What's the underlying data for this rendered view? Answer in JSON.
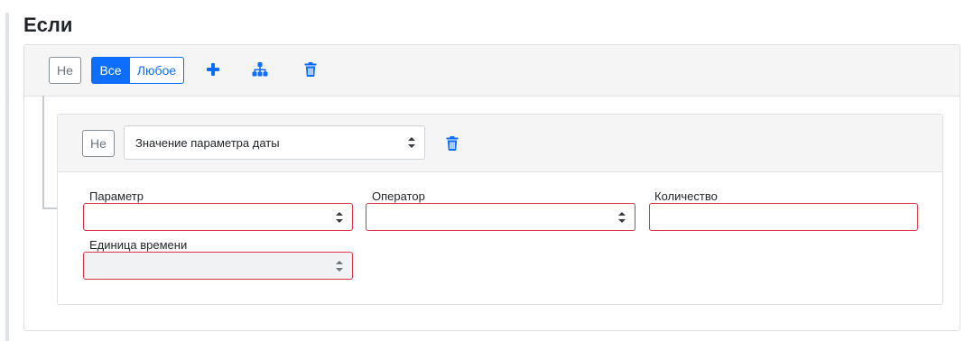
{
  "section": {
    "title": "Если"
  },
  "group": {
    "not_label": "Не",
    "all_label": "Все",
    "any_label": "Любое",
    "icons": [
      "plus-icon",
      "sitemap-icon",
      "trash-icon"
    ]
  },
  "condition": {
    "not_label": "Не",
    "type_value": "Значение параметра даты",
    "fields": {
      "parameter_label": "Параметр",
      "parameter_value": "",
      "operator_label": "Оператор",
      "operator_value": "",
      "quantity_label": "Количество",
      "quantity_value": "",
      "time_unit_label": "Единица времени",
      "time_unit_value": ""
    }
  },
  "colors": {
    "accent": "#0d6efd",
    "invalid": "#dc3545",
    "header_bg": "#f5f5f5"
  }
}
